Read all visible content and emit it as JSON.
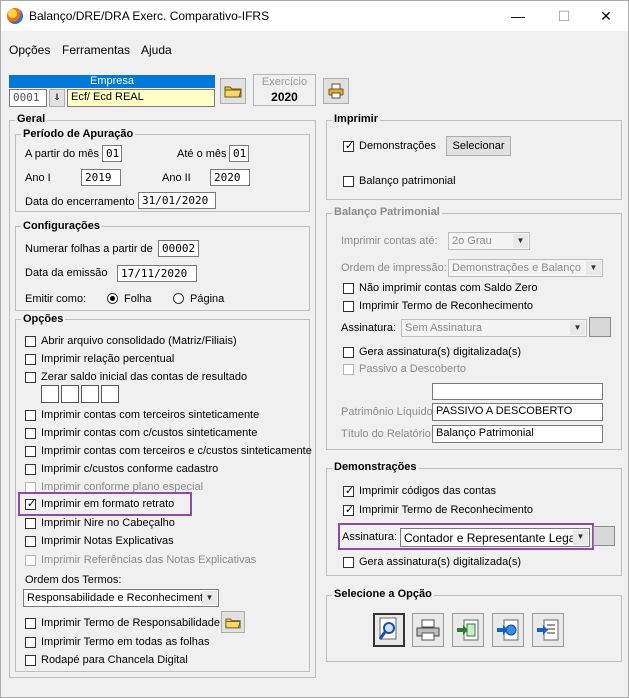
{
  "window": {
    "title": "Balanço/DRE/DRA Exerc. Comparativo-IFRS",
    "minimize": "—",
    "maximize": "☐",
    "close": "✕"
  },
  "menu": {
    "opcoes": "Opções",
    "ferramentas": "Ferramentas",
    "ajuda": "Ajuda"
  },
  "empresa": {
    "label": "Empresa",
    "code": "0001",
    "name": "Ecf/ Ecd REAL"
  },
  "exercicio": {
    "label": "Exercício",
    "year": "2020"
  },
  "geral": {
    "title": "Geral",
    "periodo": {
      "title": "Período de Apuração",
      "a_partir_label": "A partir do mês",
      "a_partir_value": "01",
      "ate_label": "Até o mês",
      "ate_value": "01",
      "ano1_label": "Ano I",
      "ano1_value": "2019",
      "ano2_label": "Ano II",
      "ano2_value": "2020",
      "data_enc_label": "Data do encerramento",
      "data_enc_value": "31/01/2020"
    },
    "config": {
      "title": "Configurações",
      "numerar_label": "Numerar folhas a partir de",
      "numerar_value": "00002",
      "emissao_label": "Data da emissão",
      "emissao_value": "17/11/2020",
      "emitir_label": "Emitir como:",
      "folha": "Folha",
      "pagina": "Página"
    },
    "opcoes": {
      "title": "Opções",
      "items": [
        "Abrir arquivo consolidado (Matriz/Filiais)",
        "Imprimir relação percentual",
        "Zerar saldo inicial das contas de resultado",
        "Imprimir contas com terceiros sinteticamente",
        "Imprimir contas com c/custos sinteticamente",
        "Imprimir contas com terceiros e c/custos sinteticamente",
        "Imprimir c/custos conforme cadastro",
        "Imprimir conforme plano especial",
        "Imprimir em formato retrato",
        "Imprimir Nire no Cabeçalho",
        "Imprimir Notas Explicativas",
        "Imprimir Referências das Notas Explicativas"
      ],
      "ordem_label": "Ordem dos Termos:",
      "ordem_value": "Responsabilidade e Reconhecimento",
      "bottom": [
        "Imprimir Termo de Responsabilidade",
        "Imprimir Termo em todas as folhas",
        "Rodapé para Chancela Digital"
      ]
    }
  },
  "imprimir": {
    "title": "Imprimir",
    "demonstracoes": "Demonstrações",
    "selecionar": "Selecionar",
    "balanco": "Balanço patrimonial"
  },
  "balanco": {
    "title": "Balanço Patrimonial",
    "contas_ate_label": "Imprimir contas até:",
    "contas_ate_value": "2o Grau",
    "ordem_label": "Ordem de impressão:",
    "ordem_value": "Demonstrações e Balanço",
    "nao_imprimir": "Não imprimir contas com Saldo Zero",
    "termo_reconhecimento": "Imprimir Termo de Reconhecimento",
    "assinatura_label": "Assinatura:",
    "assinatura_value": "Sem Assinatura",
    "gera_assinatura": "Gera assinatura(s) digitalizada(s)",
    "passivo_descoberto": "Passivo a Descoberto",
    "pl_label": "Patrimônio Líquido:",
    "pl_value": "PASSIVO A DESCOBERTO",
    "titulo_label": "Título do Relatório:",
    "titulo_value": "Balanço Patrimonial"
  },
  "demonstracoes": {
    "title": "Demonstrações",
    "codigos": "Imprimir códigos das contas",
    "termo": "Imprimir Termo de Reconhecimento",
    "assinatura_label": "Assinatura:",
    "assinatura_value": "Contador e Representante Legal",
    "gera": "Gera assinatura(s) digitalizada(s)"
  },
  "selecione": {
    "title": "Selecione a Opção"
  },
  "colors": {
    "empresa_header": "#0078d7",
    "empresa_name_bg": "#ffffc8",
    "highlight": "#8e4aa8"
  },
  "icons": [
    "folder-icon",
    "printer-small-icon",
    "search-preview-icon",
    "printer-icon",
    "excel-export-icon",
    "web-export-icon",
    "text-export-icon",
    "signature-icon"
  ]
}
